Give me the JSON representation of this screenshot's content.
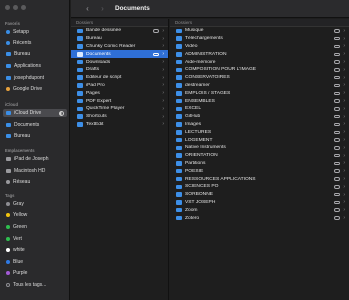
{
  "window": {
    "title": "Documents"
  },
  "sidebar": {
    "favorites_label": "Favoris",
    "favorites": [
      {
        "label": "Setapp",
        "icon": "setapp-icon"
      },
      {
        "label": "Récents",
        "icon": "clock-icon"
      },
      {
        "label": "Bureau",
        "icon": "desktop-icon"
      },
      {
        "label": "Applications",
        "icon": "applications-icon"
      },
      {
        "label": "josephdupont",
        "icon": "home-icon"
      },
      {
        "label": "Google Drive",
        "icon": "drive-icon"
      }
    ],
    "icloud_label": "iCloud",
    "icloud": [
      {
        "label": "iCloud Drive",
        "icon": "cloud-icon"
      },
      {
        "label": "Documents",
        "icon": "doc-icon"
      },
      {
        "label": "Bureau",
        "icon": "desktop-icon"
      }
    ],
    "locations_label": "Emplacements",
    "locations": [
      {
        "label": "iPad de Joseph",
        "icon": "ipad-icon"
      },
      {
        "label": "Macintosh HD",
        "icon": "disk-icon"
      },
      {
        "label": "Réseau",
        "icon": "network-icon"
      }
    ],
    "tags_label": "Tags",
    "tags": [
      {
        "label": "Gray",
        "color": "#8e8e93"
      },
      {
        "label": "Yellow",
        "color": "#f2c40f"
      },
      {
        "label": "Green",
        "color": "#2fbf4f"
      },
      {
        "label": "Vert",
        "color": "#2fbf4f"
      },
      {
        "label": "white",
        "color": "#ffffff"
      },
      {
        "label": "Blue",
        "color": "#2f7ae5"
      },
      {
        "label": "Purple",
        "color": "#a35ad6"
      },
      {
        "label": "Tous les tags...",
        "color": "#8e8e93"
      }
    ]
  },
  "column1": {
    "header": "Dossiers",
    "items": [
      {
        "label": "Bande dessinée",
        "cloud": true
      },
      {
        "label": "Bureau"
      },
      {
        "label": "Chunky Comic Reader"
      },
      {
        "label": "Documents",
        "selected": true,
        "cloud": true
      },
      {
        "label": "Downloads"
      },
      {
        "label": "Drafts"
      },
      {
        "label": "Éditeur de script"
      },
      {
        "label": "iPad Pro"
      },
      {
        "label": "Pages"
      },
      {
        "label": "PDF Expert"
      },
      {
        "label": "QuickTime Player"
      },
      {
        "label": "Shortcuts"
      },
      {
        "label": "TextEdit"
      }
    ]
  },
  "column2": {
    "header": "Dossiers",
    "items": [
      {
        "label": "Musique"
      },
      {
        "label": "Téléchargements"
      },
      {
        "label": "Vidéo"
      },
      {
        "label": "ADMINISTRATION"
      },
      {
        "label": "Aide-mémoire"
      },
      {
        "label": "COMPOSITION POUR L'IMAGE"
      },
      {
        "label": "CONSERVATOIRES"
      },
      {
        "label": "destreamer"
      },
      {
        "label": "EMPLOIS / STAGES"
      },
      {
        "label": "ENSEMBLES"
      },
      {
        "label": "EXCEL"
      },
      {
        "label": "GitHub"
      },
      {
        "label": "Images"
      },
      {
        "label": "LECTURES"
      },
      {
        "label": "LOGEMENT"
      },
      {
        "label": "Native Instruments"
      },
      {
        "label": "ORIENTATION"
      },
      {
        "label": "Partitions"
      },
      {
        "label": "POÉSIE"
      },
      {
        "label": "RESSOURCES APPLICATIONS"
      },
      {
        "label": "SCIENCES PO"
      },
      {
        "label": "SORBONNE"
      },
      {
        "label": "VST JOSEPH"
      },
      {
        "label": "Zoom"
      },
      {
        "label": "Zotero"
      }
    ]
  }
}
